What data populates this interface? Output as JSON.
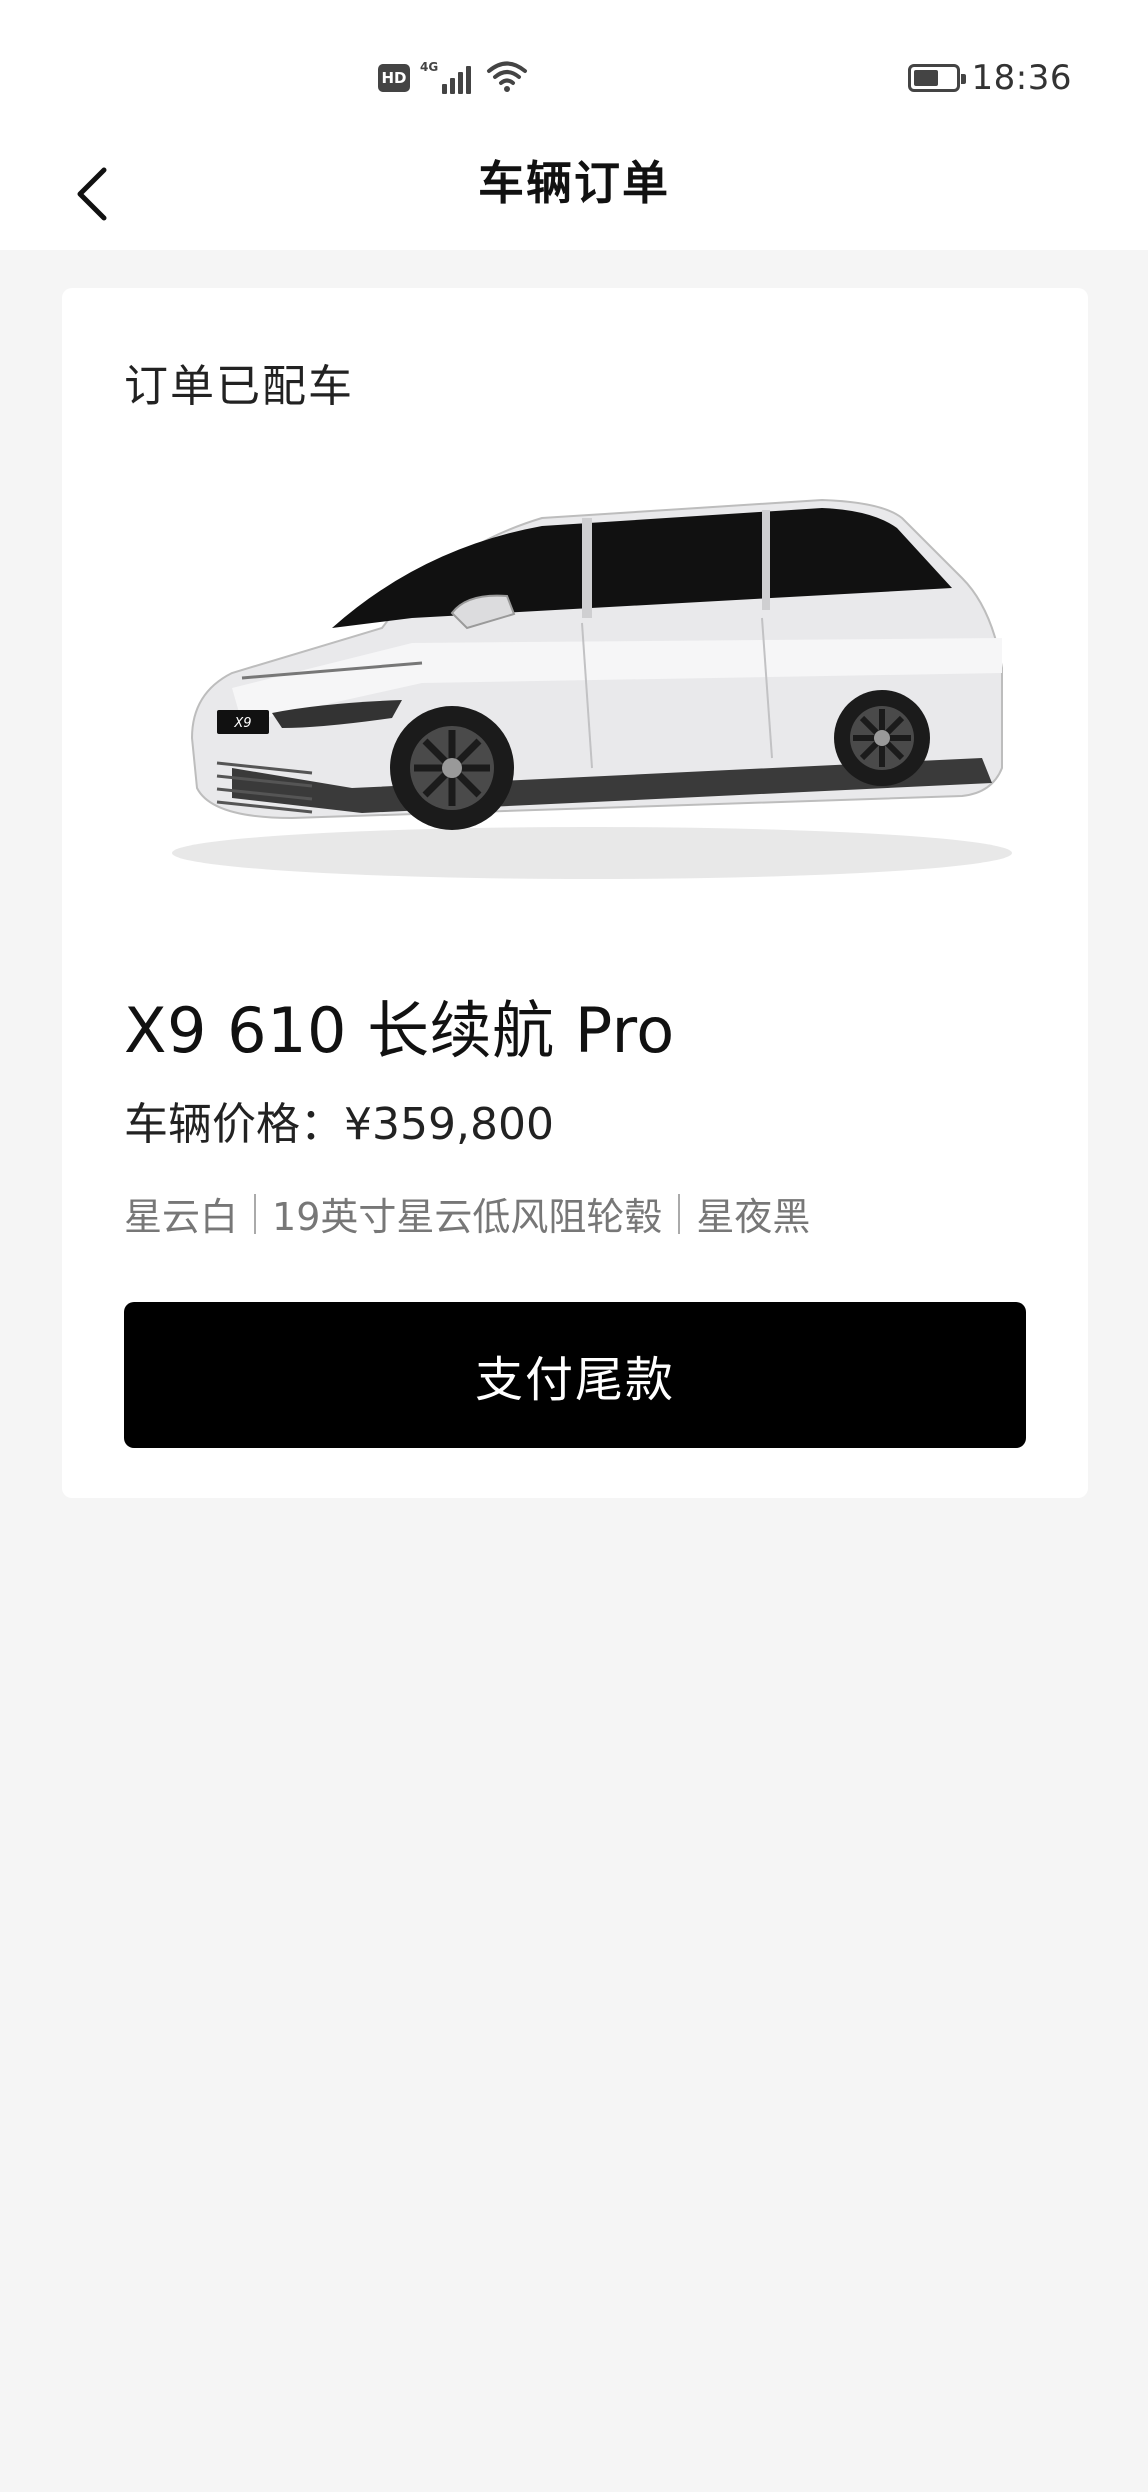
{
  "status_bar": {
    "network_badge": "HD",
    "network_type": "4G",
    "time": "18:36",
    "icons": [
      "hd-icon",
      "signal-icon",
      "wifi-icon",
      "battery-icon"
    ]
  },
  "nav": {
    "title": "车辆订单",
    "back_icon": "chevron-left-icon"
  },
  "order": {
    "status_text": "订单已配车",
    "car_image": "x9-minivan-image",
    "car_badge": "X9",
    "model_name": "X9 610 长续航 Pro",
    "price_text": "车辆价格：¥359,800",
    "config_items": [
      "星云白",
      "19英寸星云低风阻轮毂",
      "星夜黑"
    ],
    "pay_button_label": "支付尾款"
  },
  "colors": {
    "page_bg": "#f5f5f5",
    "card_bg": "#ffffff",
    "button_bg": "#000000",
    "button_text": "#ffffff",
    "secondary_text": "#777777"
  }
}
